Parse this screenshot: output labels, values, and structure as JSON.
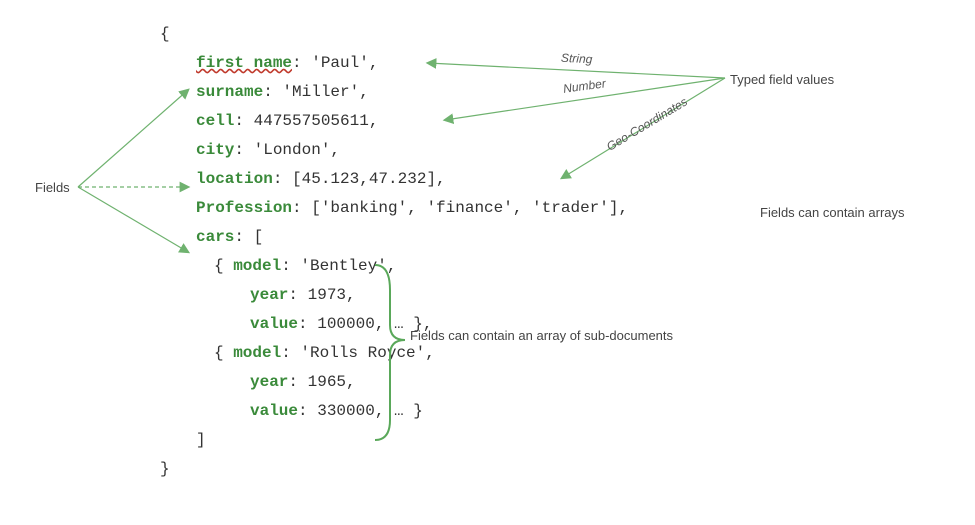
{
  "code": {
    "open_brace": "{",
    "l1_key": "first name",
    "l1_colon": ": ",
    "l1_val": "'Paul'",
    "l1_end": ",",
    "l2_key": "surname",
    "l2_colon": ": ",
    "l2_val": "'Miller'",
    "l2_end": ",",
    "l3_key": "cell",
    "l3_colon": ": ",
    "l3_val": "447557505611",
    "l3_end": ",",
    "l4_key": "city",
    "l4_colon": ": ",
    "l4_val": "'London'",
    "l4_end": ",",
    "l5_key": "location",
    "l5_colon": ": ",
    "l5_val": "[45.123,47.232]",
    "l5_end": ",",
    "l6_key": "Profession",
    "l6_colon": ": ",
    "l6_val": "['banking', 'finance', 'trader']",
    "l6_end": ",",
    "l7_key": "cars",
    "l7_colon": ": [",
    "l8_open": "{ ",
    "l8_key": "model",
    "l8_colon": ": ",
    "l8_val": "'Bentley'",
    "l8_end": ",",
    "l9_key": "year",
    "l9_colon": ": ",
    "l9_val": "1973",
    "l9_end": ",",
    "l10_key": "value",
    "l10_colon": ": ",
    "l10_val": "100000",
    "l10_end": ", … },",
    "l11_open": "{ ",
    "l11_key": "model",
    "l11_colon": ": ",
    "l11_val": "'Rolls Royce'",
    "l11_end": ",",
    "l12_key": "year",
    "l12_colon": ": ",
    "l12_val": "1965",
    "l12_end": ",",
    "l13_key": "value",
    "l13_colon": ": ",
    "l13_val": "330000",
    "l13_end": ", … }",
    "close_bracket": "]",
    "close_brace": "}"
  },
  "labels": {
    "fields": "Fields",
    "typed_values": "Typed field values",
    "arrays": "Fields can contain arrays",
    "subdocs": "Fields can contain an array of sub-documents"
  },
  "arrow_texts": {
    "string": "String",
    "number": "Number",
    "geo": "Geo-Coordinates"
  },
  "colors": {
    "key_green": "#3a8a3a",
    "arrow_green": "#6fb26f",
    "brace_green": "#5aa85a"
  }
}
